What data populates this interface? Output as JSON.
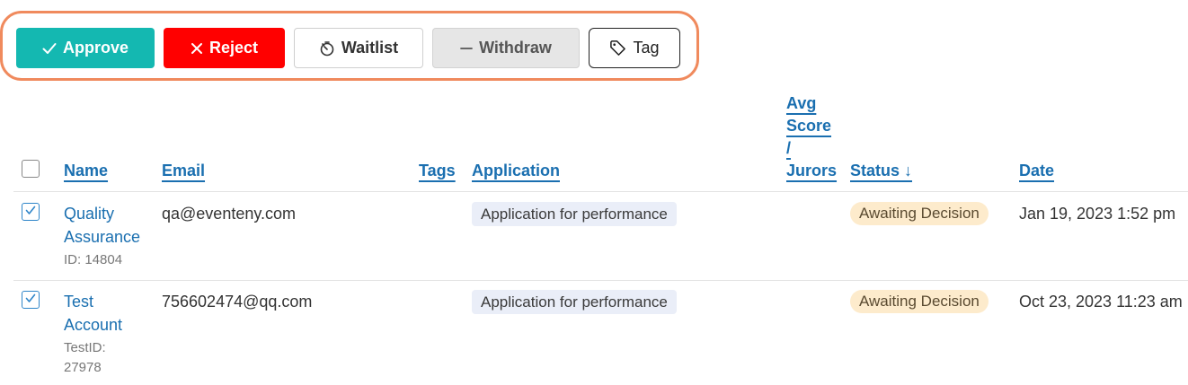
{
  "toolbar": {
    "approve_label": "Approve",
    "reject_label": "Reject",
    "waitlist_label": "Waitlist",
    "withdraw_label": "Withdraw",
    "tag_label": "Tag"
  },
  "table": {
    "columns": {
      "name": "Name",
      "email": "Email",
      "tags": "Tags",
      "application": "Application",
      "avg_score_line1": "Avg",
      "avg_score_line2": "Score",
      "avg_score_line3": "/",
      "avg_score_line4": "Jurors",
      "status": "Status ↓",
      "date": "Date"
    },
    "rows": [
      {
        "name_line1": "Quality",
        "name_line2": "Assurance",
        "id_line1": "ID: 14804",
        "email": "qa@eventeny.com",
        "application": "Application for performance",
        "status": "Awaiting Decision",
        "date": "Jan 19, 2023 1:52 pm",
        "checked": true
      },
      {
        "name_line1": "Test",
        "name_line2": "Account",
        "id_line1": "TestID:",
        "id_line2": "27978",
        "email": "756602474@qq.com",
        "application": "Application for performance",
        "status": "Awaiting Decision",
        "date": "Oct 23, 2023 11:23 am",
        "checked": true
      }
    ]
  },
  "colors": {
    "approve": "#14b8b1",
    "reject": "#ff0000",
    "link": "#1a6fb0",
    "highlight_border": "#f08a5d",
    "status_bg": "#fdebcc",
    "application_bg": "#eaeef8"
  },
  "icons": {
    "approve": "check-icon",
    "reject": "close-icon",
    "waitlist": "timer-icon",
    "withdraw": "minus-icon",
    "tag": "tag-icon"
  }
}
